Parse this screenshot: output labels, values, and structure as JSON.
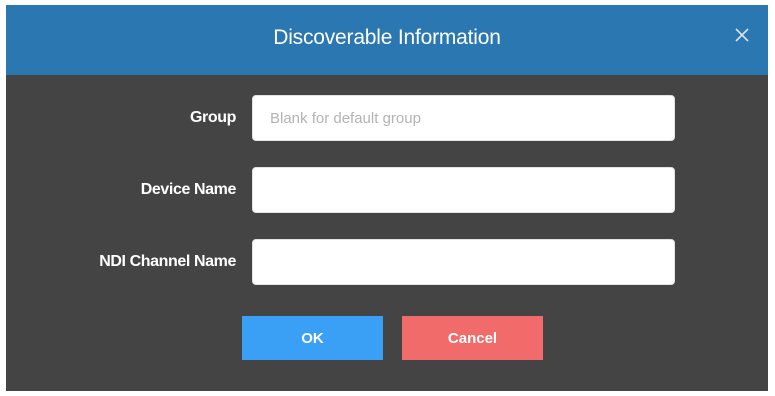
{
  "dialog": {
    "title": "Discoverable Information",
    "close_icon": "close-icon"
  },
  "fields": {
    "group": {
      "label": "Group",
      "value": "",
      "placeholder": "Blank for default group"
    },
    "device_name": {
      "label": "Device Name",
      "value": "",
      "placeholder": ""
    },
    "ndi_channel_name": {
      "label": "NDI Channel Name",
      "value": "",
      "placeholder": ""
    }
  },
  "buttons": {
    "ok_label": "OK",
    "cancel_label": "Cancel"
  },
  "colors": {
    "titlebar": "#2b77b1",
    "body": "#444444",
    "ok": "#3aa0f5",
    "cancel": "#f16b6b"
  }
}
